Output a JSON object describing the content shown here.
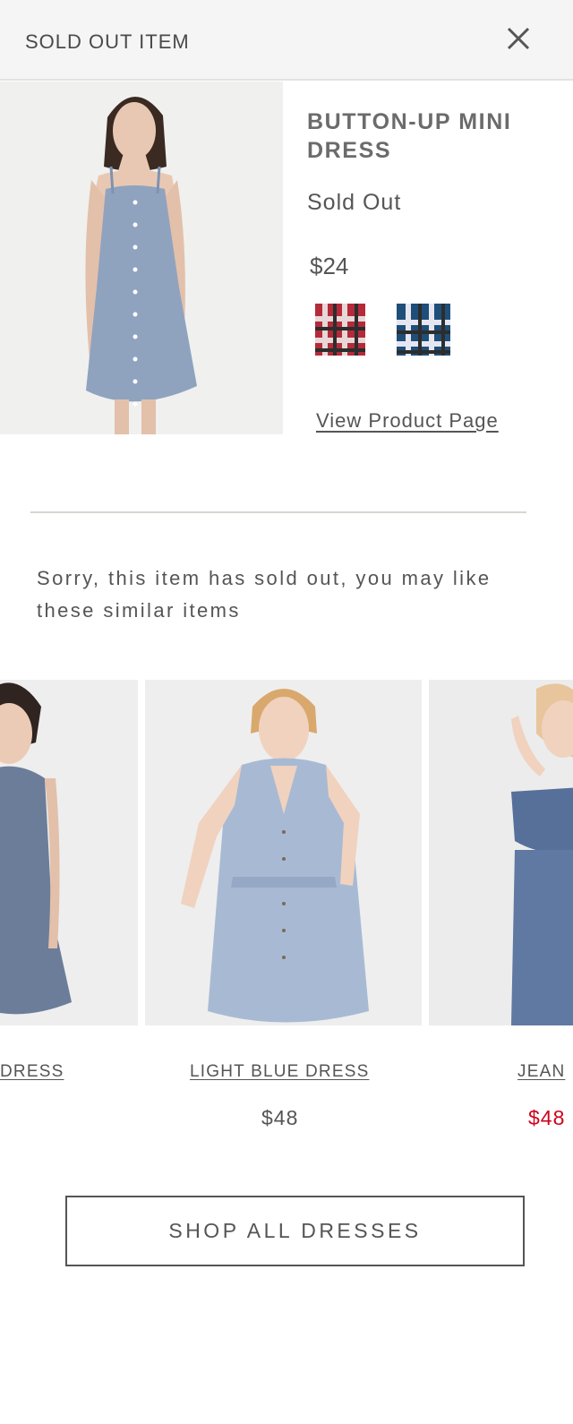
{
  "header": {
    "title": "SOLD OUT ITEM",
    "close_icon": "close-icon"
  },
  "product": {
    "name": "BUTTON-UP MINI DRESS",
    "status": "Sold Out",
    "price": "$24",
    "swatches": [
      {
        "name": "red-plaid-swatch",
        "colors": [
          "#b52a3a",
          "#e8d7d7",
          "#2d2d2d"
        ]
      },
      {
        "name": "blue-plaid-swatch",
        "colors": [
          "#1d4f7a",
          "#e6e6f0",
          "#2d2d2d"
        ]
      }
    ],
    "view_link": "View Product Page",
    "image_color": "#8fa3bf"
  },
  "message": "Sorry, this item has sold out, you may like these similar items",
  "recommendations": [
    {
      "name": "DRESS",
      "price": "",
      "color": "#6c7d99"
    },
    {
      "name": "LIGHT BLUE DRESS",
      "price": "$48",
      "color": "#a8bad3"
    },
    {
      "name": "JEAN",
      "price": "$48",
      "color": "#56709a",
      "price_color": "#d0021b"
    }
  ],
  "cta": {
    "label": "SHOP ALL DRESSES"
  }
}
